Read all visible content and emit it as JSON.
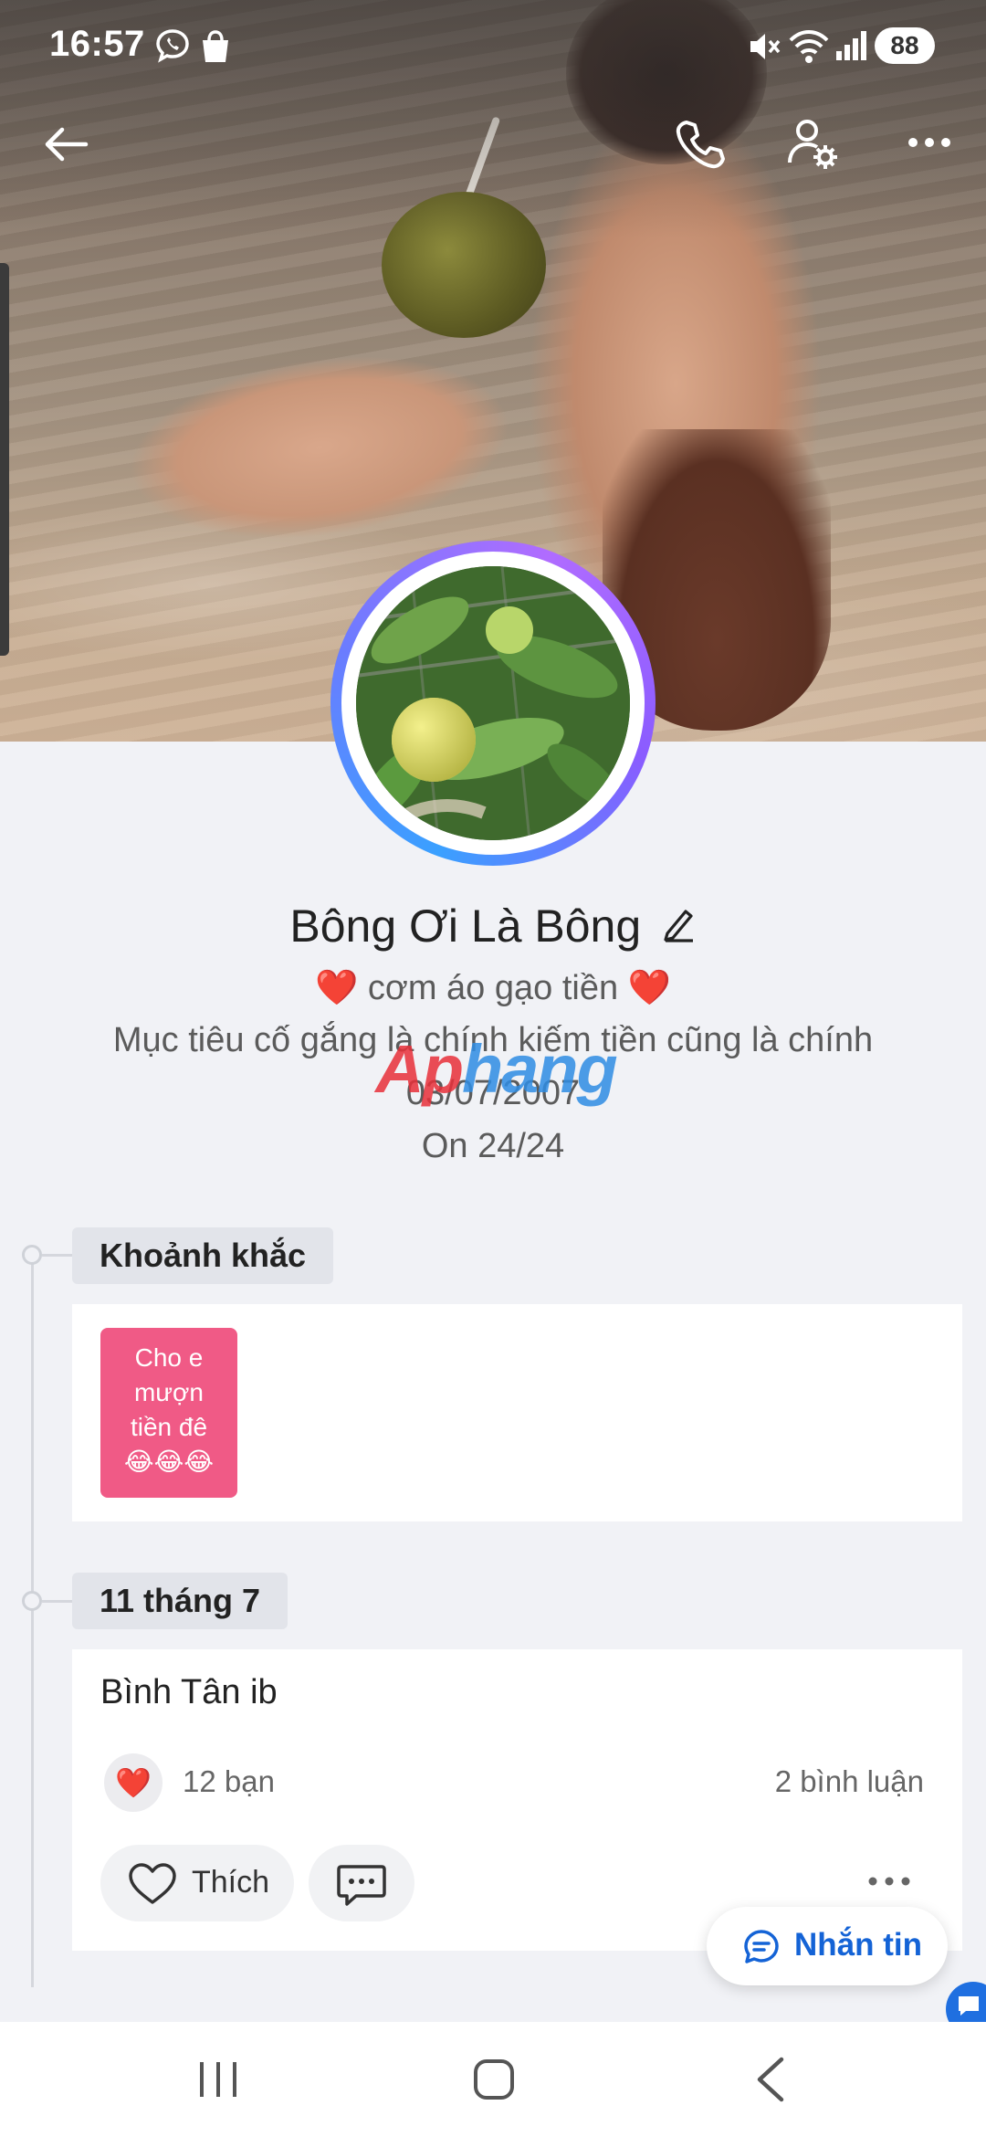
{
  "status_bar": {
    "time": "16:57",
    "battery": "88"
  },
  "profile": {
    "name": "Bông Ơi Là Bông",
    "tagline": "cơm áo gạo tiền",
    "tagline_emoji_left": "❤️",
    "tagline_emoji_right": "❤️",
    "bio": "Mục tiêu cố gắng là chính kiếm tiền cũng là chính",
    "birthday": "03/07/2007",
    "status": "On 24/24"
  },
  "watermark": {
    "part1": "Ap",
    "part2": "hang"
  },
  "moments": {
    "chip": "Khoảnh khắc",
    "tile_text": "Cho e mượn tiền đê",
    "tile_emoji": "😂😂😂"
  },
  "post": {
    "date_chip": "11 tháng 7",
    "text": "Bình Tân ib",
    "reaction_emoji": "❤️",
    "reaction_count": "12 bạn",
    "comment_count": "2 bình luận",
    "like_label": "Thích"
  },
  "fab": {
    "label": "Nhắn tin"
  },
  "colors": {
    "accent": "#1463d6",
    "moment_tile": "#f05a86"
  },
  "icons": [
    "back-arrow-icon",
    "phone-icon",
    "user-settings-icon",
    "more-icon",
    "edit-pencil-icon",
    "heart-icon",
    "comment-icon",
    "chat-icon"
  ]
}
